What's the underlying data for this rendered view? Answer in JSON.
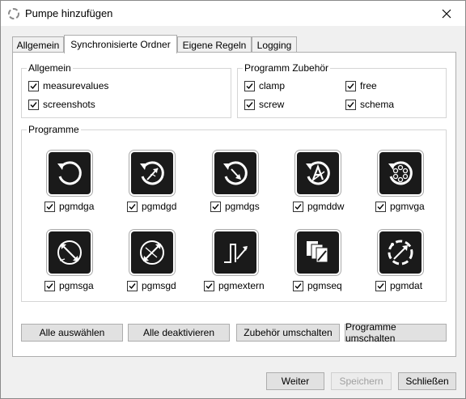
{
  "window": {
    "title": "Pumpe hinzufügen"
  },
  "tabs": [
    {
      "label": "Allgemein"
    },
    {
      "label": "Synchronisierte Ordner"
    },
    {
      "label": "Eigene Regeln"
    },
    {
      "label": "Logging"
    }
  ],
  "active_tab_index": 1,
  "allgemein_group": {
    "title": "Allgemein",
    "items": [
      {
        "label": "measurevalues",
        "checked": true
      },
      {
        "label": "screenshots",
        "checked": true
      }
    ]
  },
  "zubehoer_group": {
    "title": "Programm Zubehör",
    "items": [
      {
        "label": "clamp",
        "checked": true
      },
      {
        "label": "free",
        "checked": true
      },
      {
        "label": "screw",
        "checked": true
      },
      {
        "label": "schema",
        "checked": true
      }
    ]
  },
  "programme_group": {
    "title": "Programme",
    "items": [
      {
        "label": "pgmdga",
        "icon": "ring-arrow-icon",
        "checked": true
      },
      {
        "label": "pgmdgd",
        "icon": "ring-diagonal-arrow-icon",
        "checked": true
      },
      {
        "label": "pgmdgs",
        "icon": "ring-down-arrow-icon",
        "checked": true
      },
      {
        "label": "pgmddw",
        "icon": "ring-letter-a-icon",
        "checked": true
      },
      {
        "label": "pgmvga",
        "icon": "ring-dots-icon",
        "checked": true
      },
      {
        "label": "pgmsga",
        "icon": "ring-double-arrow-icon",
        "checked": true
      },
      {
        "label": "pgmsgd",
        "icon": "ring-crossed-arrows-icon",
        "checked": true
      },
      {
        "label": "pgmextern",
        "icon": "step-arrow-icon",
        "checked": true
      },
      {
        "label": "pgmseq",
        "icon": "stacked-cards-icon",
        "checked": true
      },
      {
        "label": "pgmdat",
        "icon": "dashed-ring-icon",
        "checked": true
      }
    ]
  },
  "action_buttons": {
    "select_all": "Alle auswählen",
    "deactivate_all": "Alle deaktivieren",
    "toggle_accessories": "Zubehör umschalten",
    "toggle_programs": "Programme umschalten"
  },
  "footer_buttons": {
    "next": "Weiter",
    "save": "Speichern",
    "close": "Schließen"
  }
}
